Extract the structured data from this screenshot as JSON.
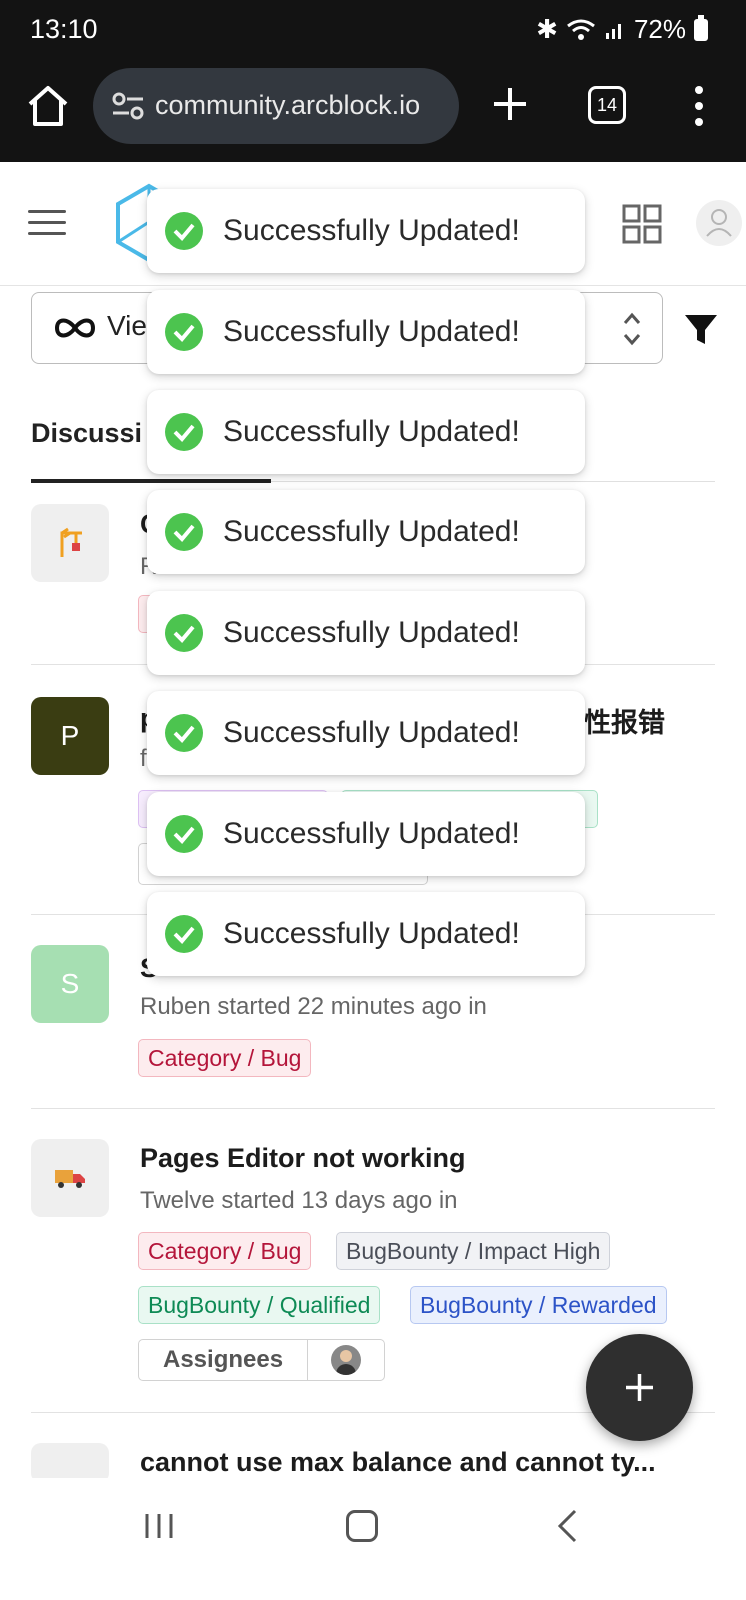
{
  "status_bar": {
    "time": "13:10",
    "battery": "72%"
  },
  "browser": {
    "url": "community.arcblock.io",
    "tab_count": "14"
  },
  "filters": {
    "view_label": "Vie"
  },
  "tabs": {
    "active": "Discussi"
  },
  "posts": [
    {
      "title_visible": "C",
      "meta_visible": "R"
    },
    {
      "avatar_letter": "P",
      "title_visible": "p",
      "title_tail": "性报错",
      "meta_visible": "f"
    },
    {
      "avatar_letter": "S",
      "title_visible": "S",
      "meta": "Ruben started 22 minutes ago in",
      "tags": [
        "Category / Bug"
      ]
    },
    {
      "title": "Pages Editor not working",
      "meta": "Twelve started 13 days ago in",
      "tags": [
        "Category / Bug",
        "BugBounty / Impact High",
        "BugBounty / Qualified",
        "BugBounty / Rewarded"
      ],
      "assignees_label": "Assignees"
    },
    {
      "title": "cannot use max balance and cannot ty..."
    }
  ],
  "toasts": [
    "Successfully Updated!",
    "Successfully Updated!",
    "Successfully Updated!",
    "Successfully Updated!",
    "Successfully Updated!",
    "Successfully Updated!",
    "Successfully Updated!",
    "Successfully Updated!"
  ],
  "icons": {
    "home": "home-icon",
    "tune": "tune-icon",
    "new_tab": "plus-icon",
    "menu": "kebab-icon",
    "hamburger": "hamburger-icon",
    "apps": "grid-icon",
    "account": "user-icon",
    "view": "infinity-icon",
    "sort": "updown-icon",
    "filter": "funnel-icon",
    "success": "check-circle-icon",
    "fab": "plus-icon"
  },
  "colors": {
    "success": "#4cc44f",
    "bug_tag": "#b4153a",
    "qualified_tag": "#0e8a55",
    "rewarded_tag": "#2c53c7"
  }
}
